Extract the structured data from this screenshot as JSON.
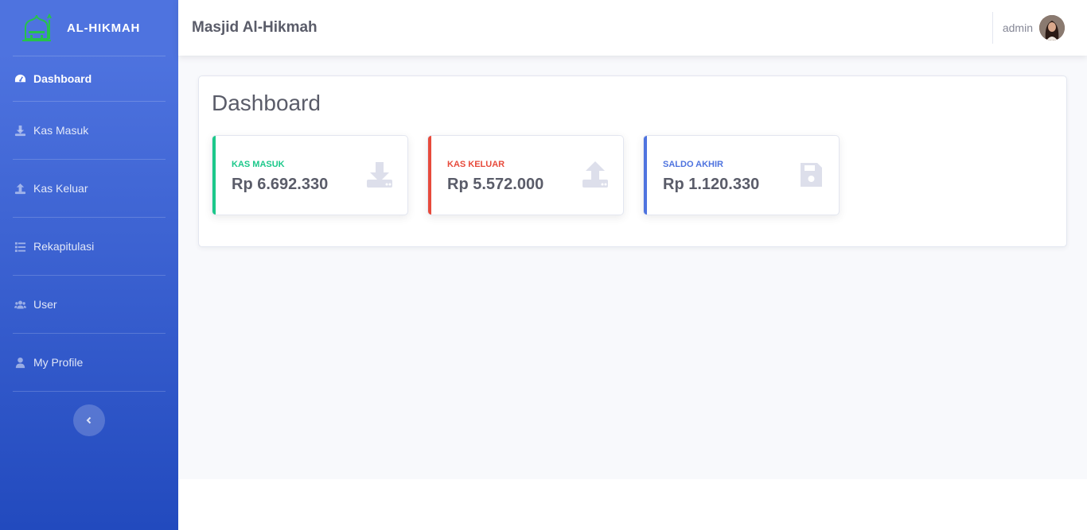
{
  "brand": {
    "name": "AL-HIKMAH"
  },
  "sidebar": {
    "items": [
      {
        "label": "Dashboard",
        "icon": "tachometer-icon"
      },
      {
        "label": "Kas Masuk",
        "icon": "download-icon"
      },
      {
        "label": "Kas Keluar",
        "icon": "upload-icon"
      },
      {
        "label": "Rekapitulasi",
        "icon": "list-icon"
      },
      {
        "label": "User",
        "icon": "users-icon"
      },
      {
        "label": "My Profile",
        "icon": "user-icon"
      }
    ],
    "toggle_icon": "chevron-left-icon"
  },
  "topbar": {
    "title": "Masjid Al-Hikmah",
    "user_name": "admin"
  },
  "main": {
    "heading": "Dashboard",
    "stats": [
      {
        "label": "KAS MASUK",
        "value": "Rp 6.692.330",
        "color": "#1cc88a",
        "icon": "download-icon"
      },
      {
        "label": "KAS KELUAR",
        "value": "Rp 5.572.000",
        "color": "#e74a3b",
        "icon": "upload-icon"
      },
      {
        "label": "SALDO AKHIR",
        "value": "Rp 1.120.330",
        "color": "#4e73df",
        "icon": "save-icon"
      }
    ]
  },
  "colors": {
    "primary": "#4e73df",
    "success": "#1cc88a",
    "danger": "#e74a3b",
    "icon_muted": "#dddfeb",
    "text": "#5a5c69"
  }
}
